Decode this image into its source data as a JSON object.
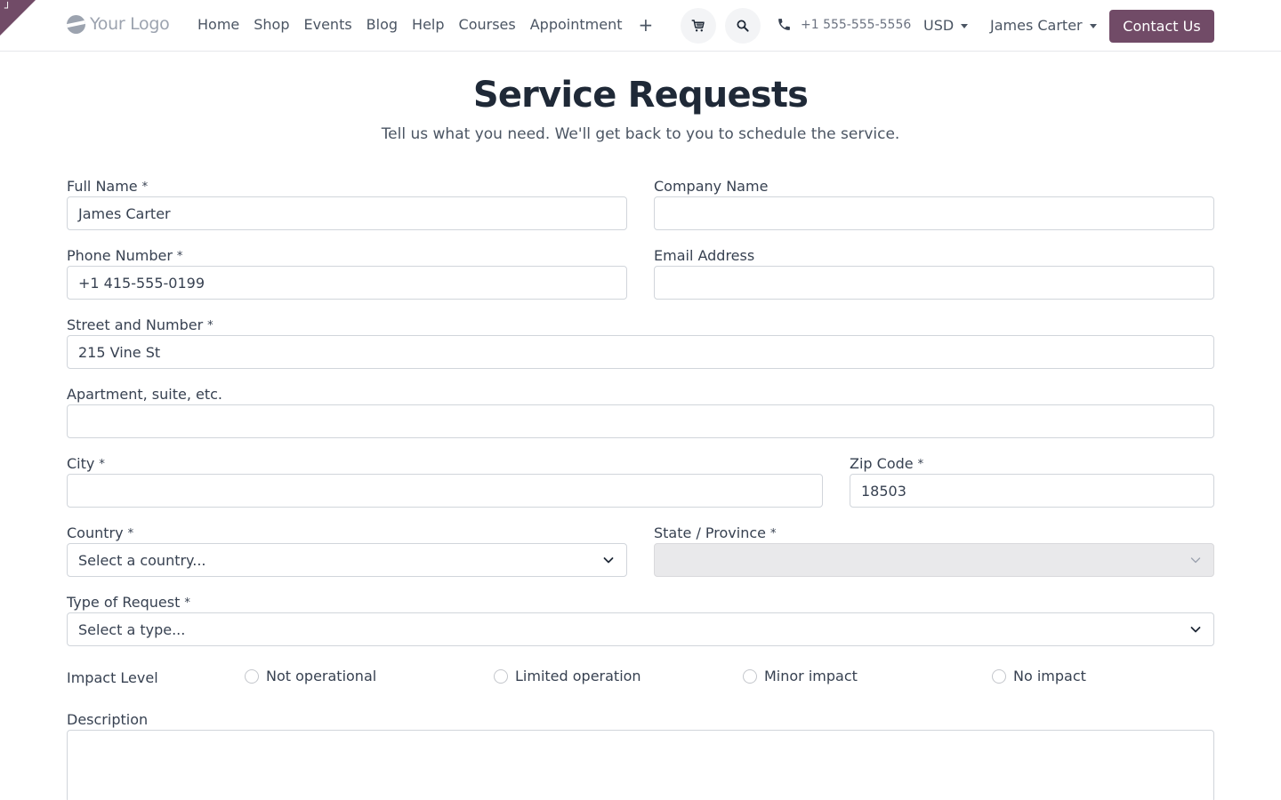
{
  "header": {
    "logo_text": "Your Logo",
    "nav": [
      "Home",
      "Shop",
      "Events",
      "Blog",
      "Help",
      "Courses",
      "Appointment"
    ],
    "nav_plus": "+",
    "phone": "+1 555-555-5556",
    "currency": "USD",
    "user": "James Carter",
    "contact_button": "Contact Us"
  },
  "page": {
    "title": "Service Requests",
    "subtitle": "Tell us what you need. We'll get back to you to schedule the service."
  },
  "form": {
    "required_mark": "*",
    "full_name": {
      "label": "Full Name",
      "value": "James Carter"
    },
    "company_name": {
      "label": "Company Name",
      "value": ""
    },
    "phone_number": {
      "label": "Phone Number",
      "value": "+1 415-555-0199"
    },
    "email_address": {
      "label": "Email Address",
      "value": ""
    },
    "street": {
      "label": "Street and Number",
      "value": "215 Vine St"
    },
    "apartment": {
      "label": "Apartment, suite, etc.",
      "value": ""
    },
    "city": {
      "label": "City",
      "value": ""
    },
    "zip": {
      "label": "Zip Code",
      "value": "18503"
    },
    "country": {
      "label": "Country",
      "value": "Select a country..."
    },
    "state": {
      "label": "State / Province",
      "value": ""
    },
    "request_type": {
      "label": "Type of Request",
      "value": "Select a type..."
    },
    "impact": {
      "label": "Impact Level",
      "options": [
        "Not operational",
        "Limited operation",
        "Minor impact",
        "No impact"
      ]
    },
    "description": {
      "label": "Description",
      "value": ""
    }
  },
  "colors": {
    "brand": "#714b67",
    "disabled_bg": "#e9e9eb",
    "border": "#d1d5db"
  }
}
